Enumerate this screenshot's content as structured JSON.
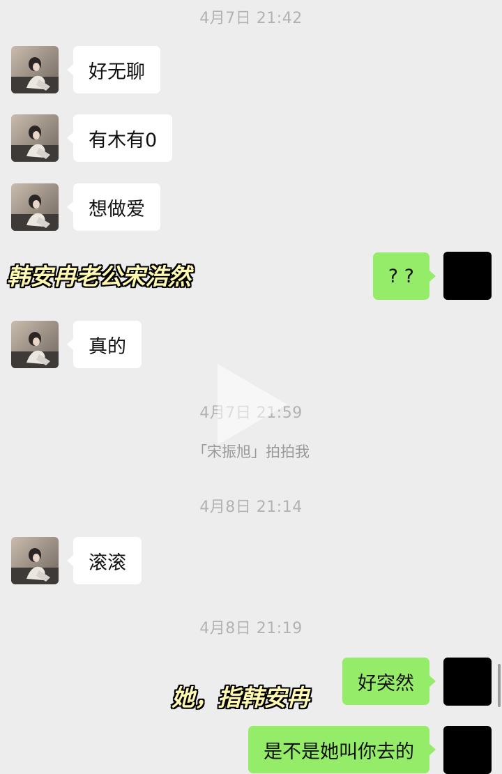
{
  "timestamps": [
    "4月7日 21:42",
    "4月7日 21:59",
    "4月8日 21:14",
    "4月8日 21:19"
  ],
  "system_message": "「宋振旭」拍拍我",
  "messages": [
    {
      "side": "left",
      "text": "好无聊"
    },
    {
      "side": "left",
      "text": "有木有0"
    },
    {
      "side": "left",
      "text": "想做爱"
    },
    {
      "side": "right",
      "text": "? ?"
    },
    {
      "side": "left",
      "text": "真的"
    },
    {
      "side": "left",
      "text": "滚滚"
    },
    {
      "side": "right",
      "text": "好突然"
    },
    {
      "side": "right",
      "text": "是不是她叫你去的"
    }
  ],
  "captions": [
    "韩安冉老公宋浩然",
    "她，指韩安冉"
  ],
  "colors": {
    "background": "#ededed",
    "self_bubble": "#95ec69",
    "other_bubble": "#ffffff",
    "timestamp": "#b2b2b2"
  },
  "icons": {
    "video_overlay": "play-icon"
  }
}
